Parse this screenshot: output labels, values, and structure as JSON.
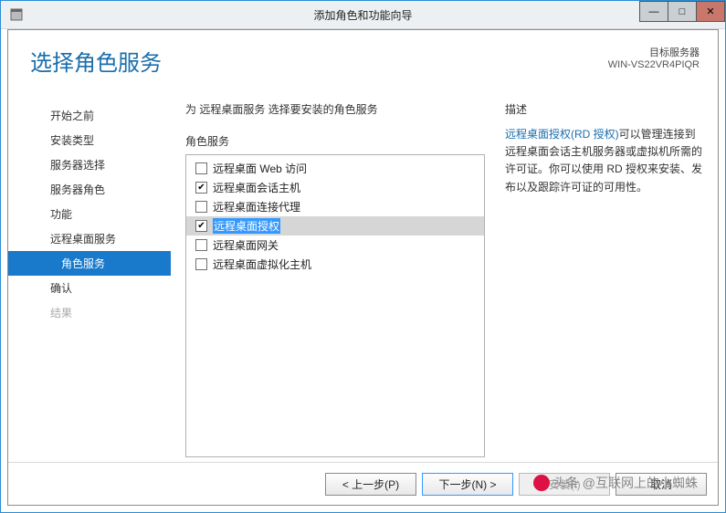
{
  "window": {
    "title": "添加角色和功能向导",
    "min_btn": "—",
    "max_btn": "□",
    "close_btn": "✕"
  },
  "header": {
    "title": "选择角色服务",
    "target_label": "目标服务器",
    "target_server": "WIN-VS22VR4PIQR"
  },
  "nav": {
    "items": [
      {
        "label": "开始之前",
        "disabled": false
      },
      {
        "label": "安装类型",
        "disabled": false
      },
      {
        "label": "服务器选择",
        "disabled": false
      },
      {
        "label": "服务器角色",
        "disabled": false
      },
      {
        "label": "功能",
        "disabled": false
      },
      {
        "label": "远程桌面服务",
        "disabled": false
      },
      {
        "label": "角色服务",
        "disabled": false,
        "sub": true,
        "selected": true
      },
      {
        "label": "确认",
        "disabled": false
      },
      {
        "label": "结果",
        "disabled": true
      }
    ]
  },
  "main": {
    "instruction": "为 远程桌面服务 选择要安装的角色服务",
    "roles_label": "角色服务",
    "roles": [
      {
        "label": "远程桌面 Web 访问",
        "checked": false,
        "highlight": false
      },
      {
        "label": "远程桌面会话主机",
        "checked": true,
        "highlight": false
      },
      {
        "label": "远程桌面连接代理",
        "checked": false,
        "highlight": false
      },
      {
        "label": "远程桌面授权",
        "checked": true,
        "highlight": true
      },
      {
        "label": "远程桌面网关",
        "checked": false,
        "highlight": false
      },
      {
        "label": "远程桌面虚拟化主机",
        "checked": false,
        "highlight": false
      }
    ],
    "desc_label": "描述",
    "desc_link": "远程桌面授权(RD 授权)",
    "desc_body": "可以管理连接到远程桌面会话主机服务器或虚拟机所需的许可证。你可以使用 RD 授权来安装、发布以及跟踪许可证的可用性。"
  },
  "footer": {
    "prev": "< 上一步(P)",
    "next": "下一步(N) >",
    "install": "安装(I)",
    "cancel": "取消"
  },
  "watermark": "头条 @互联网上的小蜘蛛"
}
